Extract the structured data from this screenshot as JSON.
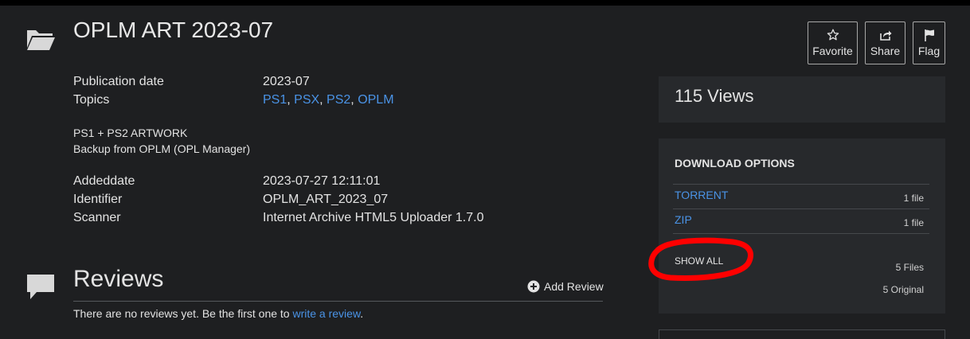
{
  "item": {
    "title": "OPLM ART 2023-07",
    "publication_date_label": "Publication date",
    "publication_date_value": "2023-07",
    "topics_label": "Topics",
    "topics": [
      "PS1",
      "PSX",
      "PS2",
      "OPLM"
    ],
    "topic_separator": ", ",
    "description_line1": "PS1 + PS2 ARTWORK",
    "description_line2": "Backup from OPLM (OPL Manager)",
    "addeddate_label": "Addeddate",
    "addeddate_value": "2023-07-27 12:11:01",
    "identifier_label": "Identifier",
    "identifier_value": "OPLM_ART_2023_07",
    "scanner_label": "Scanner",
    "scanner_value": "Internet Archive HTML5 Uploader 1.7.0"
  },
  "actions": {
    "favorite_label": "Favorite",
    "share_label": "Share",
    "flag_label": "Flag"
  },
  "stats": {
    "views": "115 Views"
  },
  "download": {
    "heading": "DOWNLOAD OPTIONS",
    "options": [
      {
        "label": "TORRENT",
        "count": "1 file"
      },
      {
        "label": "ZIP",
        "count": "1 file"
      }
    ],
    "show_all_label": "SHOW ALL",
    "files_count": "5 Files",
    "original_count": "5 Original"
  },
  "reviews": {
    "title": "Reviews",
    "add_label": "Add Review",
    "empty_text_prefix": "There are no reviews yet. Be the first one to ",
    "empty_link": "write a review",
    "empty_text_suffix": "."
  },
  "annotation": {
    "color": "#ff0000"
  },
  "icons": [
    "folder-icon",
    "star-icon",
    "share-icon",
    "flag-icon",
    "comment-icon",
    "plus-circle-icon"
  ]
}
